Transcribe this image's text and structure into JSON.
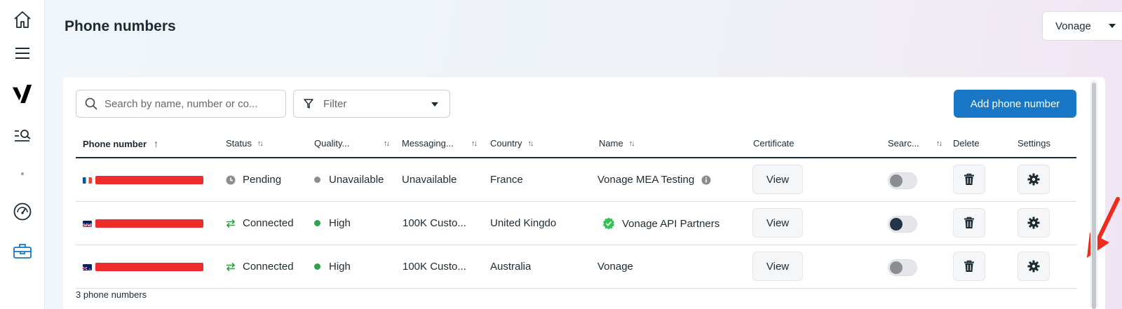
{
  "page": {
    "title": "Phone numbers"
  },
  "account": {
    "name": "Vonage"
  },
  "toolbar": {
    "search_placeholder": "Search by name, number or co...",
    "filter_label": "Filter",
    "add_button": "Add phone number"
  },
  "table": {
    "columns": {
      "phone": "Phone number",
      "status": "Status",
      "quality": "Quality...",
      "messaging": "Messaging...",
      "country": "Country",
      "name": "Name",
      "certificate": "Certificate",
      "search": "Searc...",
      "delete": "Delete",
      "settings": "Settings"
    },
    "rows": [
      {
        "status": "Pending",
        "quality": "Unavailable",
        "messaging": "Unavailable",
        "country": "France",
        "name": "Vonage MEA Testing",
        "certificate": "View",
        "searchable": false
      },
      {
        "status": "Connected",
        "quality": "High",
        "messaging": "100K Custo...",
        "country": "United Kingdo",
        "name": "Vonage API Partners",
        "certificate": "View",
        "searchable": true
      },
      {
        "status": "Connected",
        "quality": "High",
        "messaging": "100K Custo...",
        "country": "Australia",
        "name": "Vonage",
        "certificate": "View",
        "searchable": false
      }
    ],
    "count_label": "3 phone numbers"
  },
  "colors": {
    "primary": "#1877c7",
    "connected": "#2ea043",
    "high": "#31a24c",
    "unavailable": "#8a8d91",
    "redaction": "#ee2c2c",
    "annotation_arrow": "#f02a1e"
  },
  "icons": {
    "rail": [
      "home-icon",
      "menu-icon",
      "vonage-logo-icon",
      "search-list-icon",
      "dashboard-gauge-icon",
      "toolbox-icon"
    ],
    "status_pending": "clock-icon",
    "status_connected": "sync-arrows-icon",
    "verified": "verified-check-icon",
    "info": "info-icon",
    "delete": "trash-icon",
    "settings": "gear-icon"
  }
}
